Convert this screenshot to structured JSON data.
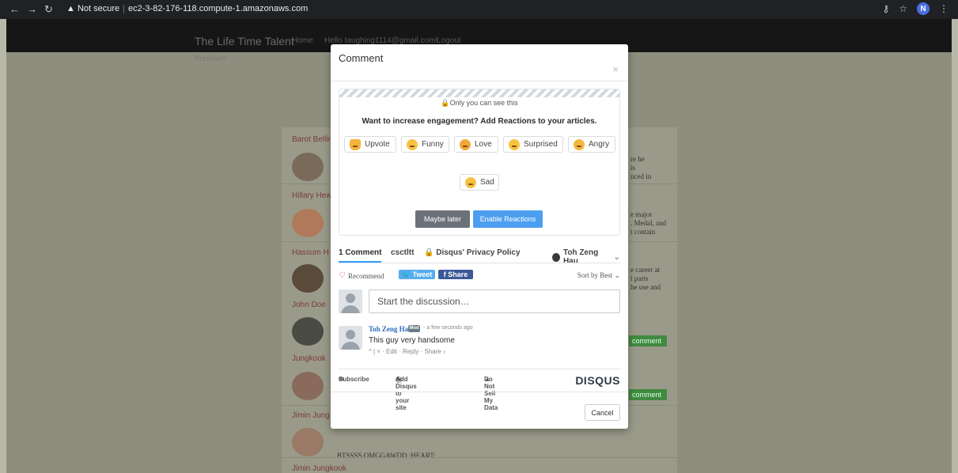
{
  "browser": {
    "security": "Not secure",
    "url": "ec2-3-82-176-118.compute-1.amazonaws.com",
    "profile_initial": "N"
  },
  "site": {
    "brand": "The Life Time Talent",
    "nav_home": "Home",
    "nav_user": "Hello taughing1114@gmail.com!",
    "nav_logout": "Logout",
    "sub": "Premium"
  },
  "background_list": {
    "names": [
      "Barot Bellin",
      "Hillary Hew",
      "Hassum H",
      "John Doe",
      "Jungkook",
      "Jimin Jung",
      "Jimin Jungkook"
    ],
    "snippets": [
      "re he\nis\nnced in",
      "e major\n. Medal, and\nt contain",
      "e career at\nl parts\nhe use and"
    ],
    "comment_btn": "comment",
    "bts_text": "BTSSSS OMGGAWDD :HEART:"
  },
  "modal": {
    "title": "Comment",
    "close": "×",
    "only_you": "Only you can see this",
    "promo": "Want to increase engagement? Add Reactions to your articles.",
    "reactions": [
      {
        "label": "Upvote",
        "icon": "thumbs-up-icon"
      },
      {
        "label": "Funny",
        "icon": "laughing-face-icon"
      },
      {
        "label": "Love",
        "icon": "heart-eyes-icon"
      },
      {
        "label": "Surprised",
        "icon": "surprised-face-icon"
      },
      {
        "label": "Angry",
        "icon": "angry-face-icon"
      },
      {
        "label": "Sad",
        "icon": "sad-face-icon"
      }
    ],
    "maybe_later": "Maybe later",
    "enable_reactions": "Enable Reactions",
    "tabs": {
      "comments": "1 Comment",
      "forum": "csctltt",
      "privacy": "Disqus' Privacy Policy",
      "user": "Toh Zeng Hau"
    },
    "recommend": "Recommend",
    "tweet": "Tweet",
    "share": "Share",
    "sort": "Sort by Best",
    "compose_placeholder": "Start the discussion…",
    "comment": {
      "author": "Toh Zeng Hau",
      "badge": "Mod",
      "time": "- a few seconds ago",
      "text": "This guy very handsome",
      "actions": "^ | ˅ · Edit · Reply · Share ›"
    },
    "footer": {
      "subscribe": "Subscribe",
      "add_disqus": "Add Disqus to your site",
      "do_not_sell": "Do Not Sell My Data",
      "logo": "DISQUS"
    },
    "cancel": "Cancel"
  },
  "colors": {
    "accent": "#2e9fff",
    "enable_btn": "#4c9ef0",
    "tweet": "#55acee",
    "share": "#3b5998",
    "link": "#2e6cb8"
  }
}
